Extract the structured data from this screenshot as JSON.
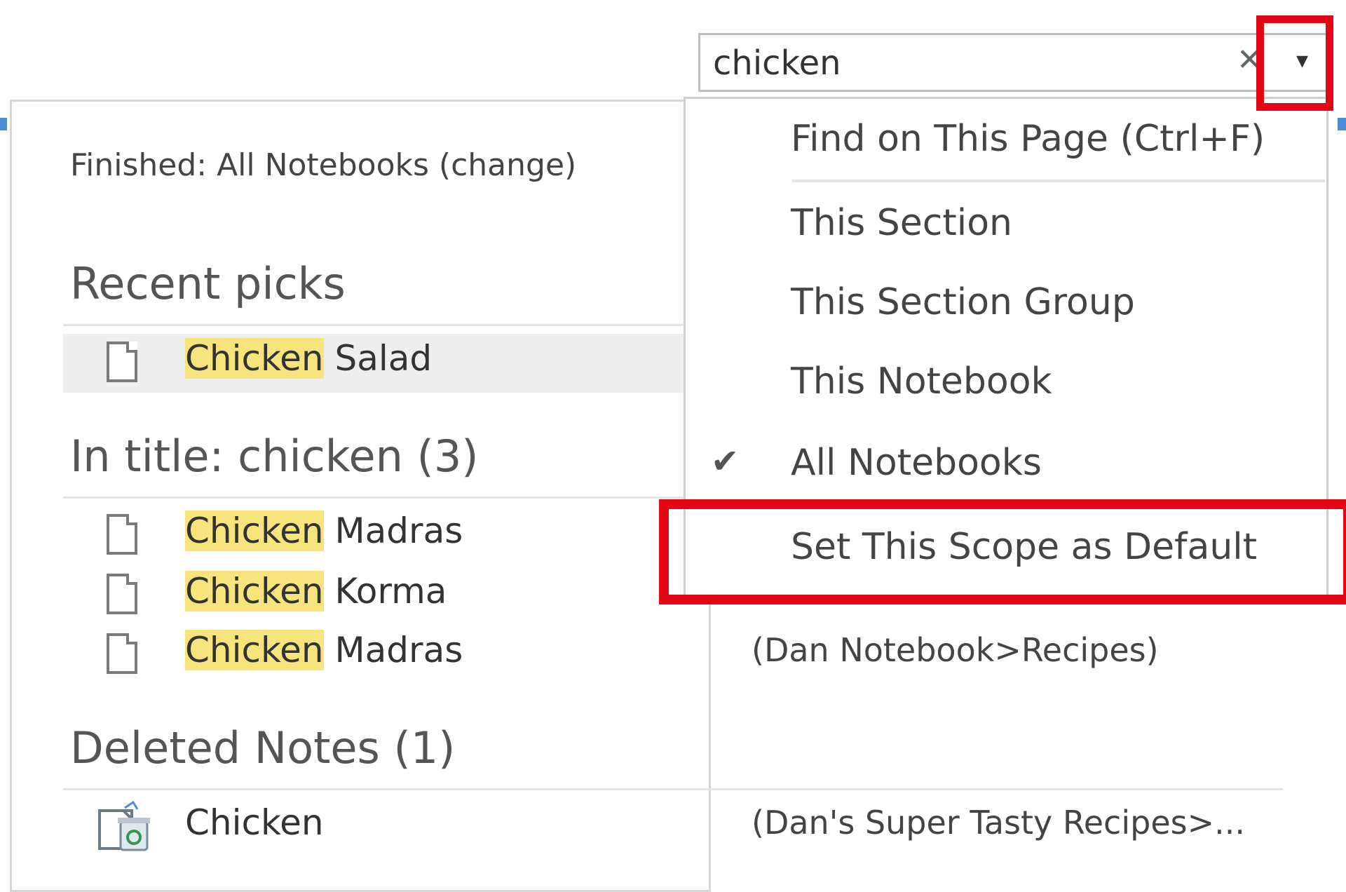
{
  "search": {
    "value": "chicken",
    "clear_glyph": "✕",
    "dropdown_glyph": "▾"
  },
  "status": {
    "text": "Finished:  All Notebooks (change)"
  },
  "sections": {
    "recent": {
      "heading": "Recent picks",
      "items": [
        {
          "highlight": "Chicken",
          "rest": " Salad",
          "icon": "page-icon"
        }
      ]
    },
    "in_title": {
      "heading": "In title:  chicken (3)",
      "items": [
        {
          "highlight": "Chicken",
          "rest": " Madras",
          "icon": "page-icon"
        },
        {
          "highlight": "Chicken",
          "rest": " Korma",
          "icon": "page-icon"
        },
        {
          "highlight": "Chicken",
          "rest": " Madras",
          "icon": "page-icon",
          "location": "(Dan Notebook>Recipes)"
        }
      ]
    },
    "deleted": {
      "heading": "Deleted Notes (1)",
      "items": [
        {
          "text": "Chicken",
          "location": "(Dan's Super Tasty Recipes>...",
          "icon": "recycle-bin-icon"
        }
      ]
    }
  },
  "scope_menu": {
    "items": [
      {
        "label": "Find on This Page (Ctrl+F)",
        "checked": false
      },
      {
        "label": "This Section",
        "checked": false
      },
      {
        "label": "This Section Group",
        "checked": false
      },
      {
        "label": "This Notebook",
        "checked": false
      },
      {
        "label": "All Notebooks",
        "checked": true
      },
      {
        "label": "Set This Scope as Default",
        "checked": false
      }
    ],
    "check_glyph": "✔"
  },
  "colors": {
    "highlight": "#f7e47d",
    "annotation_red": "#e30613",
    "accent_blue": "#4a8cd8"
  }
}
